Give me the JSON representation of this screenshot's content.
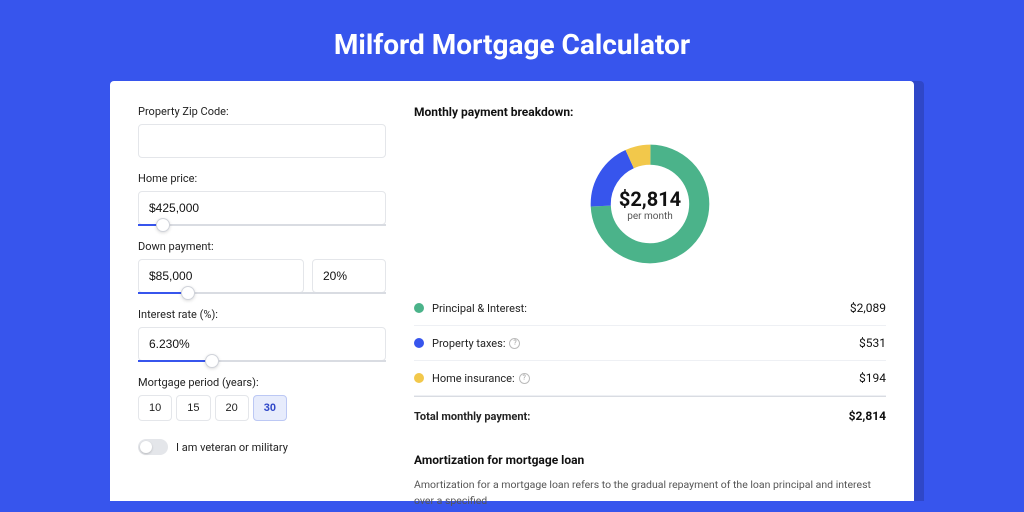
{
  "title": "Milford Mortgage Calculator",
  "form": {
    "zip": {
      "label": "Property Zip Code:",
      "value": ""
    },
    "home_price": {
      "label": "Home price:",
      "value": "$425,000",
      "slider_pct": 10
    },
    "down_payment": {
      "label": "Down payment:",
      "amount": "$85,000",
      "percent": "20%",
      "slider_pct": 20
    },
    "interest_rate": {
      "label": "Interest rate (%):",
      "value": "6.230%",
      "slider_pct": 30
    },
    "period": {
      "label": "Mortgage period (years):",
      "options": [
        "10",
        "15",
        "20",
        "30"
      ],
      "active": "30"
    },
    "veteran": {
      "label": "I am veteran or military",
      "on": false
    }
  },
  "breakdown": {
    "title": "Monthly payment breakdown:",
    "center_amount": "$2,814",
    "center_sub": "per month",
    "items": [
      {
        "label": "Principal & Interest:",
        "value": "$2,089",
        "num": 2089,
        "color": "#4bb38a",
        "info": false
      },
      {
        "label": "Property taxes:",
        "value": "$531",
        "num": 531,
        "color": "#3755ed",
        "info": true
      },
      {
        "label": "Home insurance:",
        "value": "$194",
        "num": 194,
        "color": "#f2c84b",
        "info": true
      }
    ],
    "total": {
      "label": "Total monthly payment:",
      "value": "$2,814"
    }
  },
  "amortization": {
    "title": "Amortization for mortgage loan",
    "body": "Amortization for a mortgage loan refers to the gradual repayment of the loan principal and interest over a specified"
  },
  "chart_data": {
    "type": "pie",
    "title": "Monthly payment breakdown",
    "categories": [
      "Principal & Interest",
      "Property taxes",
      "Home insurance"
    ],
    "values": [
      2089,
      531,
      194
    ],
    "colors": [
      "#4bb38a",
      "#3755ed",
      "#f2c84b"
    ],
    "center_label": "$2,814 per month",
    "total": 2814
  }
}
